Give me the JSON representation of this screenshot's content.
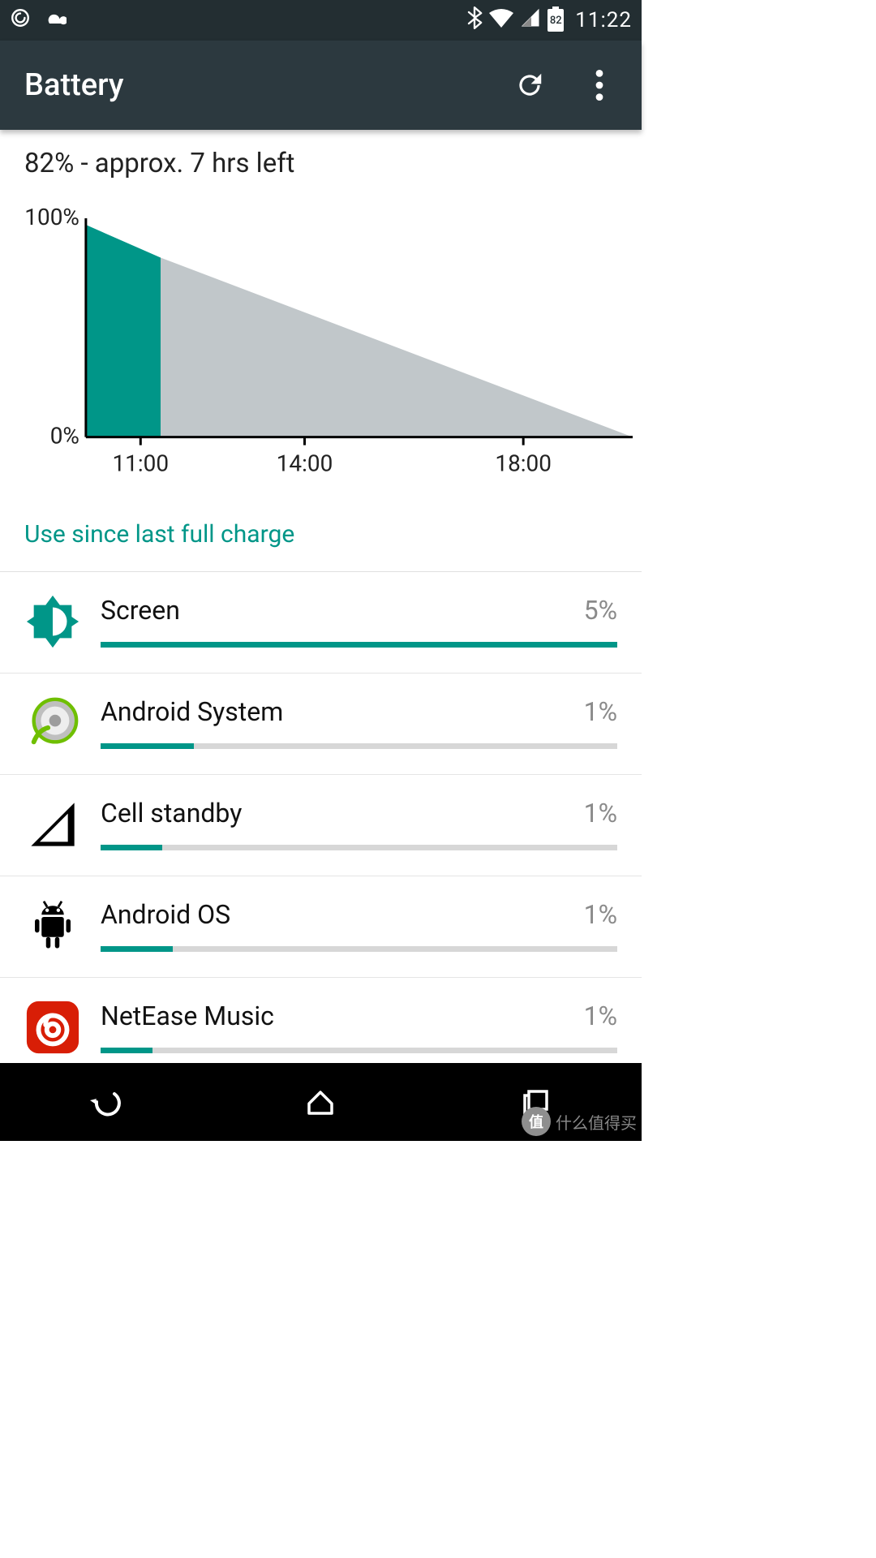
{
  "status": {
    "battery_pct": "82",
    "time": "11:22"
  },
  "appbar": {
    "title": "Battery"
  },
  "summary": "82% - approx. 7 hrs left",
  "chart_data": {
    "type": "area",
    "title": "",
    "xlabel": "",
    "ylabel": "",
    "ylim": [
      0,
      100
    ],
    "y_tick_labels": [
      "0%",
      "100%"
    ],
    "x_tick_labels": [
      "11:00",
      "14:00",
      "18:00"
    ],
    "x_range_minutes": [
      600,
      1200
    ],
    "x_ticks_minutes": [
      660,
      840,
      1080
    ],
    "series": [
      {
        "name": "actual",
        "color": "#009688",
        "x": [
          600,
          682
        ],
        "values": [
          97,
          82
        ]
      },
      {
        "name": "projected",
        "color": "#c1c7ca",
        "x": [
          682,
          1200
        ],
        "values": [
          82,
          0
        ]
      }
    ]
  },
  "section_header": "Use since last full charge",
  "usage": [
    {
      "name": "Screen",
      "pct": "5%",
      "bar": 100,
      "icon": "brightness"
    },
    {
      "name": "Android System",
      "pct": "1%",
      "bar": 18,
      "icon": "android-system"
    },
    {
      "name": "Cell standby",
      "pct": "1%",
      "bar": 12,
      "icon": "cell"
    },
    {
      "name": "Android OS",
      "pct": "1%",
      "bar": 14,
      "icon": "android"
    },
    {
      "name": "NetEase Music",
      "pct": "1%",
      "bar": 10,
      "icon": "netease"
    }
  ],
  "watermark": {
    "badge": "值",
    "text": "什么值得买"
  }
}
